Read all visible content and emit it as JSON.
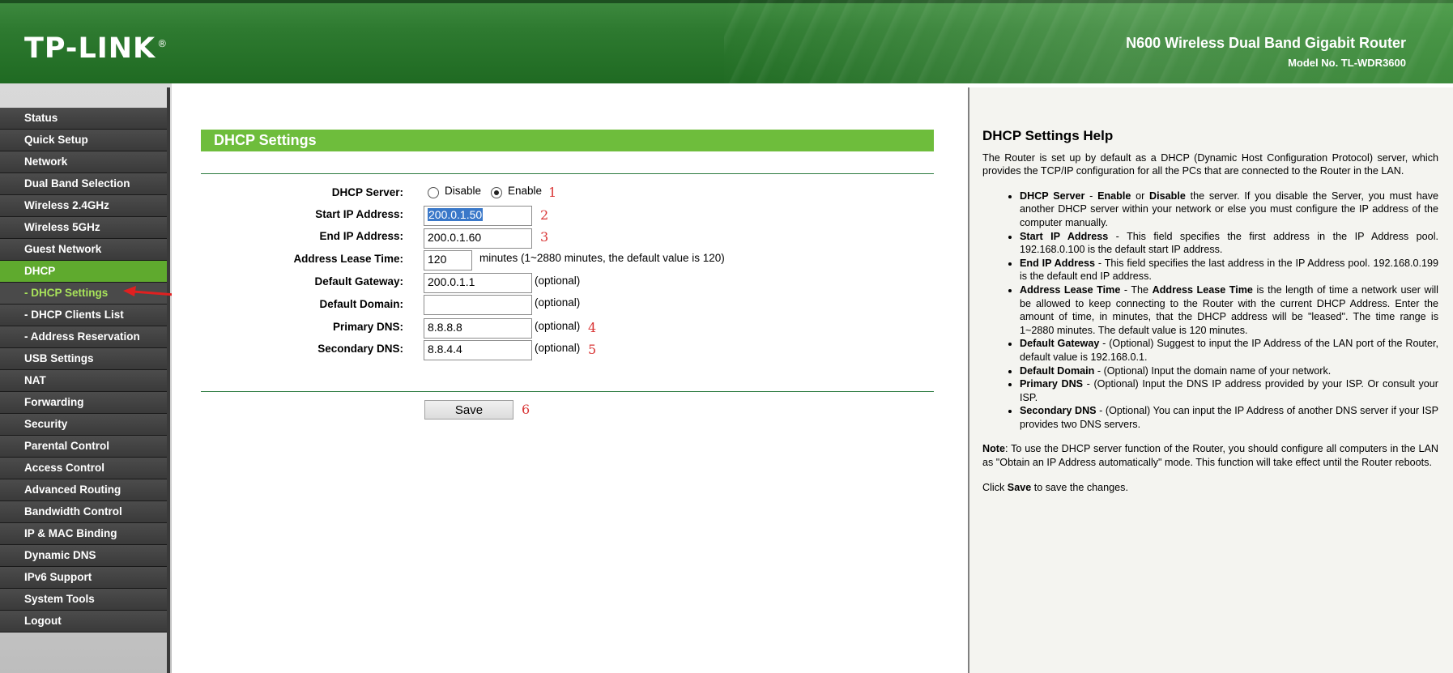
{
  "header": {
    "logo_text": "TP-LINK",
    "logo_reg": "®",
    "product_name": "N600 Wireless Dual Band Gigabit Router",
    "model_no": "Model No. TL-WDR3600"
  },
  "sidebar": {
    "items": [
      {
        "label": "Status"
      },
      {
        "label": "Quick Setup"
      },
      {
        "label": "Network"
      },
      {
        "label": "Dual Band Selection"
      },
      {
        "label": "Wireless 2.4GHz"
      },
      {
        "label": "Wireless 5GHz"
      },
      {
        "label": "Guest Network"
      },
      {
        "label": "DHCP"
      },
      {
        "label": "- DHCP Settings"
      },
      {
        "label": "- DHCP Clients List"
      },
      {
        "label": "- Address Reservation"
      },
      {
        "label": "USB Settings"
      },
      {
        "label": "NAT"
      },
      {
        "label": "Forwarding"
      },
      {
        "label": "Security"
      },
      {
        "label": "Parental Control"
      },
      {
        "label": "Access Control"
      },
      {
        "label": "Advanced Routing"
      },
      {
        "label": "Bandwidth Control"
      },
      {
        "label": "IP & MAC Binding"
      },
      {
        "label": "Dynamic DNS"
      },
      {
        "label": "IPv6 Support"
      },
      {
        "label": "System Tools"
      },
      {
        "label": "Logout"
      }
    ]
  },
  "main": {
    "section_title": "DHCP Settings",
    "dhcp_server": {
      "label": "DHCP Server:",
      "disable_label": "Disable",
      "enable_label": "Enable",
      "selected": "Enable"
    },
    "start_ip": {
      "label": "Start IP Address:",
      "value": "200.0.1.50"
    },
    "end_ip": {
      "label": "End IP Address:",
      "value": "200.0.1.60"
    },
    "lease_time": {
      "label": "Address Lease Time:",
      "value": "120",
      "hint": "minutes (1~2880 minutes, the default value is 120)"
    },
    "gateway": {
      "label": "Default Gateway:",
      "value": "200.0.1.1",
      "hint": "(optional)"
    },
    "domain": {
      "label": "Default Domain:",
      "value": "",
      "hint": "(optional)"
    },
    "primary_dns": {
      "label": "Primary DNS:",
      "value": "8.8.8.8",
      "hint": "(optional)"
    },
    "secondary_dns": {
      "label": "Secondary DNS:",
      "value": "8.8.4.4",
      "hint": "(optional)"
    },
    "save_label": "Save",
    "annotations": [
      "1",
      "2",
      "3",
      "4",
      "5",
      "6"
    ]
  },
  "help": {
    "title": "DHCP Settings Help",
    "intro": "The Router is set up by default as a DHCP (Dynamic Host Configuration Protocol) server, which provides the TCP/IP configuration for all the PCs that are connected to the Router in the LAN.",
    "items": [
      {
        "pre_b": "DHCP Server",
        "t1": " - ",
        "b2": "Enable",
        "t2": " or ",
        "b3": "Disable",
        "t3": " the server. If you disable the Server, you must have another DHCP server within your network or else you must configure the IP address of the computer manually."
      },
      {
        "pre_b": "Start IP Address",
        "t1": " - This field specifies the first address in the IP Address pool. 192.168.0.100 is the default start IP address."
      },
      {
        "pre_b": "End IP Address",
        "t1": " - This field specifies the last address in the IP Address pool. 192.168.0.199 is the default end IP address."
      },
      {
        "pre_b": "Address Lease Time",
        "t1": " - The ",
        "b2": "Address Lease Time",
        "t2": " is the length of time a network user will be allowed to keep connecting to the Router with the current DHCP Address. Enter the amount of time, in minutes, that the DHCP address will be \"leased\". The time range is 1~2880 minutes. The default value is 120 minutes."
      },
      {
        "pre_b": "Default Gateway",
        "t1": " - (Optional) Suggest to input the IP Address of the LAN port of the Router, default value is 192.168.0.1."
      },
      {
        "pre_b": "Default Domain",
        "t1": " - (Optional) Input the domain name of your network."
      },
      {
        "pre_b": "Primary DNS",
        "t1": " - (Optional) Input the DNS IP address provided by your ISP. Or consult your ISP."
      },
      {
        "pre_b": "Secondary DNS",
        "t1": " - (Optional) You can input the IP Address of another DNS server if your ISP provides two DNS servers."
      }
    ],
    "note_label": "Note",
    "note_text": ": To use the DHCP server function of the Router, you should configure all computers in the LAN as \"Obtain an IP Address automatically\" mode. This function will take effect until the Router reboots.",
    "click_pre": "Click ",
    "click_b": "Save",
    "click_post": " to save the changes."
  },
  "colors": {
    "accent_green": "#6ebd3c",
    "header_green": "#2e7a30",
    "nav_dark": "#3a3a3a",
    "annotation_red": "#d93535"
  }
}
